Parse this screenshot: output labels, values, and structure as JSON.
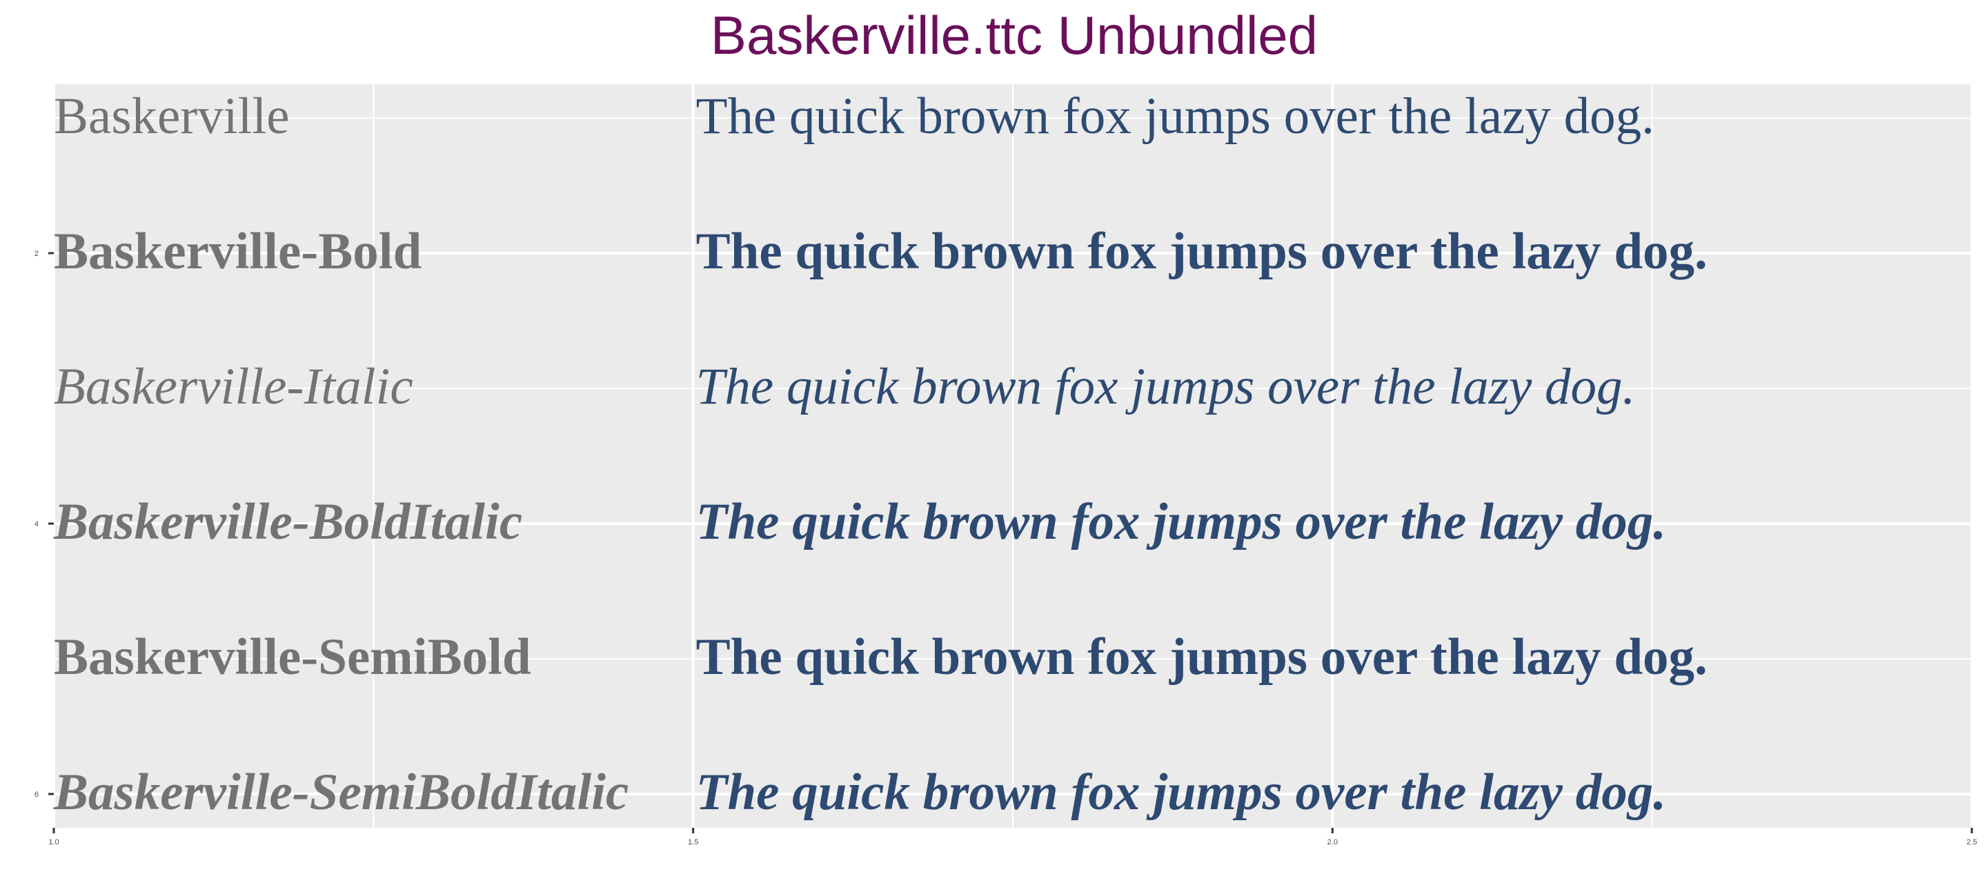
{
  "chart_data": {
    "type": "table",
    "title": "Baskerville.ttc Unbundled",
    "xlim": [
      1.0,
      2.5
    ],
    "ylim": [
      6.25,
      0.75
    ],
    "x_ticks": [
      1.0,
      1.5,
      2.0,
      2.5
    ],
    "x_tick_labels": [
      "1.0",
      "1.5",
      "2.0",
      "2.5"
    ],
    "y_ticks": [
      2,
      4,
      6
    ],
    "y_tick_labels": [
      "2",
      "4",
      "6"
    ],
    "grid": true,
    "name_x": 1.0,
    "sample_x": 1.5,
    "rows": [
      {
        "y": 1,
        "name": "Baskerville",
        "sample": "The quick brown fox jumps over the lazy dog.",
        "weight": "normal",
        "style": "normal"
      },
      {
        "y": 2,
        "name": "Baskerville-Bold",
        "sample": "The quick brown fox jumps over the lazy dog.",
        "weight": "bold",
        "style": "normal"
      },
      {
        "y": 3,
        "name": "Baskerville-Italic",
        "sample": "The quick brown fox jumps over the lazy dog.",
        "weight": "normal",
        "style": "italic"
      },
      {
        "y": 4,
        "name": "Baskerville-BoldItalic",
        "sample": "The quick brown fox jumps over the lazy dog.",
        "weight": "bold",
        "style": "italic"
      },
      {
        "y": 5,
        "name": "Baskerville-SemiBold",
        "sample": "The quick brown fox jumps over the lazy dog.",
        "weight": "bold",
        "style": "normal"
      },
      {
        "y": 6,
        "name": "Baskerville-SemiBoldItalic",
        "sample": "The quick brown fox jumps over the lazy dog.",
        "weight": "bold",
        "style": "italic"
      }
    ]
  },
  "colors": {
    "title": "#6a0f5a",
    "panel_background": "#ebebeb",
    "grid": "#ffffff",
    "font_name": "#737373",
    "sample": "#2e4a72",
    "axis": "#333333"
  }
}
